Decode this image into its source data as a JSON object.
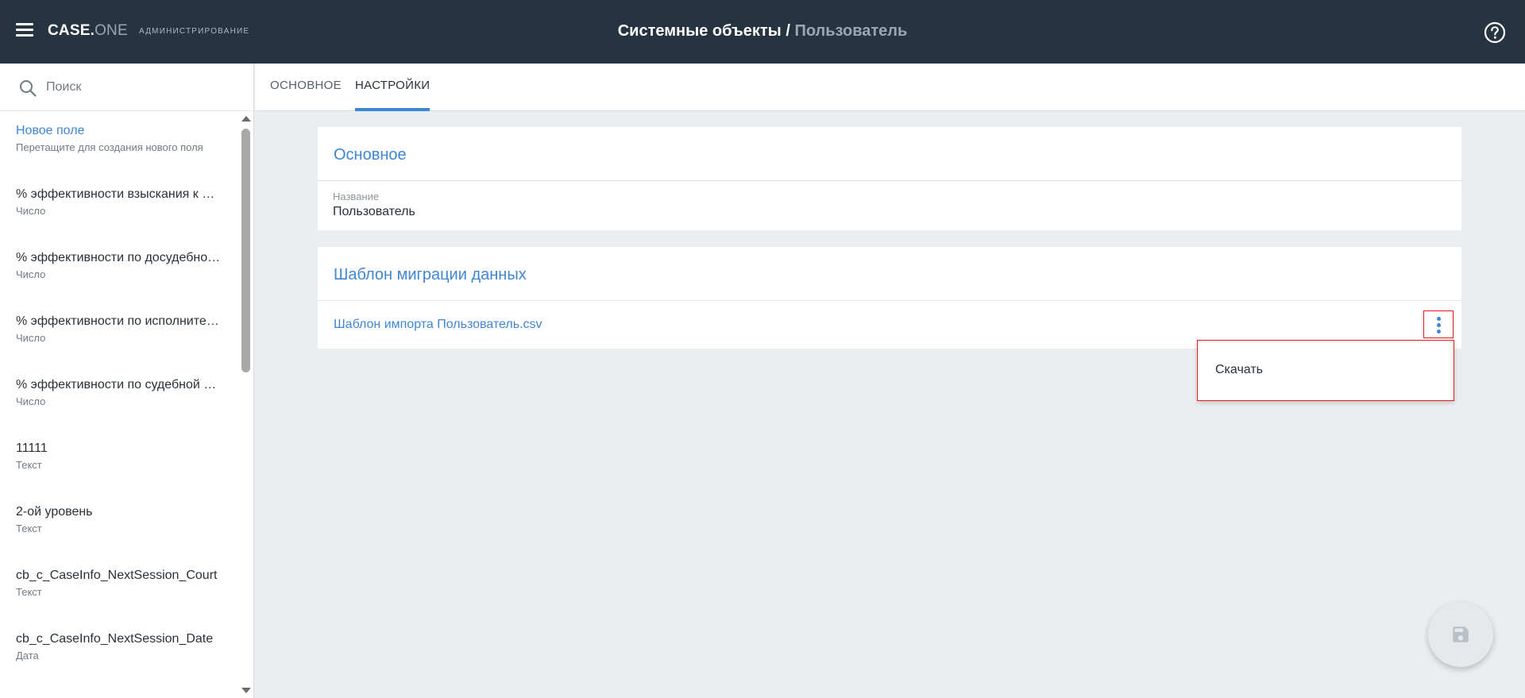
{
  "header": {
    "brand_a": "CASE.",
    "brand_b": "ONE",
    "section": "АДМИНИСТРИРОВАНИЕ",
    "title": "Системные объекты",
    "separator": "/",
    "subtitle": "Пользователь"
  },
  "sidebar": {
    "search_placeholder": "Поиск",
    "new_field": {
      "name": "Новое поле",
      "hint": "Перетащите для создания нового поля"
    },
    "items": [
      {
        "name": "% эффективности взыскания к …",
        "type": "Число"
      },
      {
        "name": "% эффективности по досудебно…",
        "type": "Число"
      },
      {
        "name": "% эффективности по исполните…",
        "type": "Число"
      },
      {
        "name": "% эффективности по судебной р…",
        "type": "Число"
      },
      {
        "name": "11111",
        "type": "Текст"
      },
      {
        "name": "2-ой уровень",
        "type": "Текст"
      },
      {
        "name": "cb_c_CaseInfo_NextSession_Court",
        "type": "Текст"
      },
      {
        "name": "cb_c_CaseInfo_NextSession_Date",
        "type": "Дата"
      }
    ]
  },
  "tabs": [
    {
      "label": "ОСНОВНОЕ",
      "active": false
    },
    {
      "label": "НАСТРОЙКИ",
      "active": true
    }
  ],
  "basic_card": {
    "title": "Основное",
    "field_label": "Название",
    "field_value": "Пользователь"
  },
  "migration_card": {
    "title": "Шаблон миграции данных",
    "file_name": "Шаблон импорта Пользователь.csv"
  },
  "menu": {
    "items": [
      "Скачать"
    ]
  },
  "colors": {
    "header_bg": "#263441",
    "accent": "#3f86d3",
    "highlight_border": "#e21a1a"
  },
  "icons": [
    "menu-icon",
    "help-icon",
    "search-icon",
    "more-vert-icon",
    "save-icon"
  ]
}
